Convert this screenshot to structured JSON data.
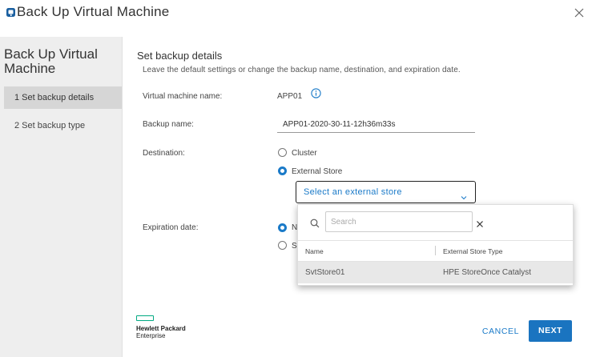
{
  "dialog": {
    "title": "Back Up Virtual Machine",
    "close_icon": "close-icon",
    "title_icon": "vm-backup-icon"
  },
  "sidebar": {
    "title": "Back Up Virtual Machine",
    "steps": [
      {
        "label": "1 Set backup details",
        "active": true
      },
      {
        "label": "2 Set backup type",
        "active": false
      }
    ]
  },
  "form": {
    "section_title": "Set backup details",
    "section_subtitle": "Leave the default settings or change the backup name, destination, and expiration date.",
    "vm_name_label": "Virtual machine name:",
    "vm_name_value": "APP01",
    "info_icon": "info-icon",
    "backup_name_label": "Backup name:",
    "backup_name_value": "APP01-2020-30-11-12h36m33s",
    "destination_label": "Destination:",
    "destination_options": [
      {
        "label": "Cluster",
        "checked": false
      },
      {
        "label": "External Store",
        "checked": true
      }
    ],
    "store_select_placeholder": "Select an external store",
    "expiration_label": "Expiration date:",
    "expiration_partial_1": "N",
    "expiration_partial_2": "S"
  },
  "dropdown": {
    "search_placeholder": "Search",
    "columns": [
      "Name",
      "External Store Type"
    ],
    "rows": [
      {
        "name": "SvtStore01",
        "type": "HPE StoreOnce Catalyst"
      }
    ]
  },
  "footer": {
    "logo_line1": "Hewlett Packard",
    "logo_line2": "Enterprise",
    "cancel_label": "CANCEL",
    "next_label": "NEXT"
  },
  "colors": {
    "accent": "#1a7ac8",
    "primary_button": "#1a74c0",
    "hpe_green": "#01a982",
    "sidebar_bg": "#eeeeee",
    "active_step_bg": "#d6d6d6"
  }
}
